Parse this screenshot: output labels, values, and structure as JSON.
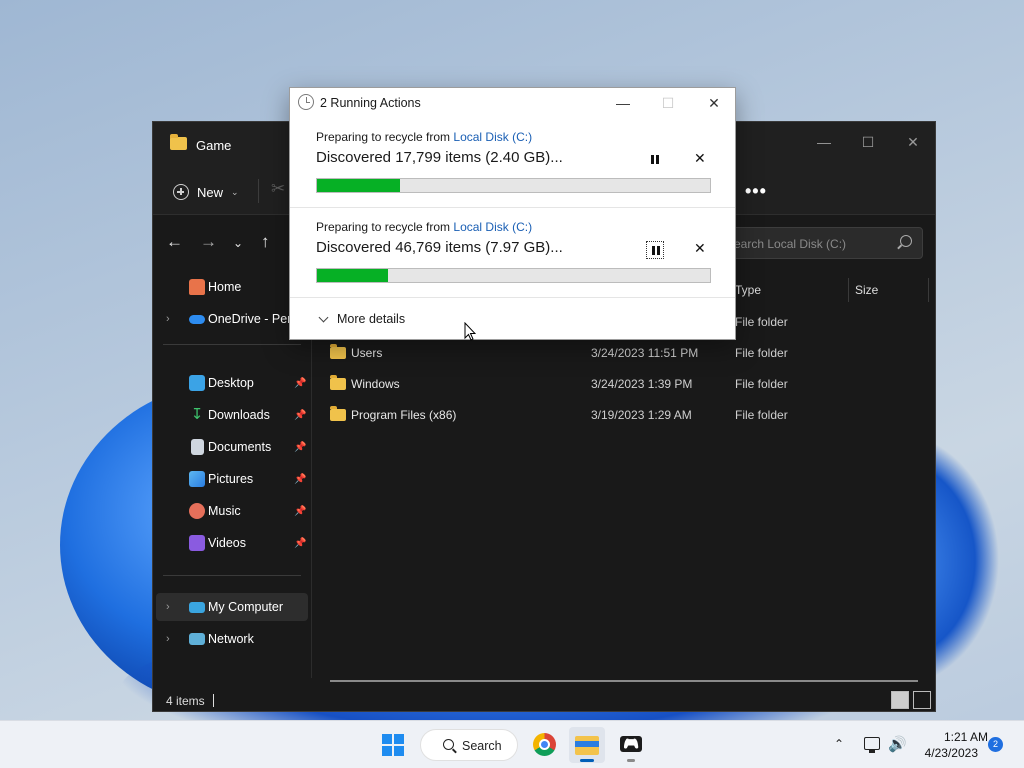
{
  "explorer": {
    "title": "Game",
    "toolbar": {
      "new_label": "New",
      "new_chevron": "⌄",
      "more_label": "•••"
    },
    "search_placeholder": "earch Local Disk (C:)",
    "sidebar": {
      "items": [
        {
          "label": "Home",
          "icon": "home-icon"
        },
        {
          "label": "OneDrive - Pers",
          "icon": "onedrive-icon"
        },
        {
          "label": "Desktop",
          "icon": "desktop-icon"
        },
        {
          "label": "Downloads",
          "icon": "download-icon"
        },
        {
          "label": "Documents",
          "icon": "documents-icon"
        },
        {
          "label": "Pictures",
          "icon": "pictures-icon"
        },
        {
          "label": "Music",
          "icon": "music-icon"
        },
        {
          "label": "Videos",
          "icon": "videos-icon"
        },
        {
          "label": "My Computer",
          "icon": "computer-icon"
        },
        {
          "label": "Network",
          "icon": "network-icon"
        }
      ]
    },
    "columns": {
      "type": "Type",
      "size": "Size"
    },
    "rows": [
      {
        "name": "",
        "date": "",
        "type": "File folder"
      },
      {
        "name": "Users",
        "date": "3/24/2023 11:51 PM",
        "type": "File folder"
      },
      {
        "name": "Windows",
        "date": "3/24/2023 1:39 PM",
        "type": "File folder"
      },
      {
        "name": "Program Files (x86)",
        "date": "3/19/2023 1:29 AM",
        "type": "File folder"
      }
    ],
    "status": "4 items"
  },
  "dialog": {
    "title": "2 Running Actions",
    "operations": [
      {
        "prefix": "Preparing to recycle from ",
        "link": "Local Disk (C:)",
        "status": "Discovered 17,799 items (2.40 GB)...",
        "progress": 0.21
      },
      {
        "prefix": "Preparing to recycle from ",
        "link": "Local Disk (C:)",
        "status": "Discovered 46,769 items (7.97 GB)...",
        "progress": 0.18
      }
    ],
    "more_details": "More details"
  },
  "taskbar": {
    "search_label": "Search",
    "time": "1:21 AM",
    "date": "4/23/2023",
    "notification_count": "2"
  },
  "colors": {
    "progress_fill": "#06b025",
    "link": "#1a5fb4",
    "accent": "#005fb8"
  }
}
